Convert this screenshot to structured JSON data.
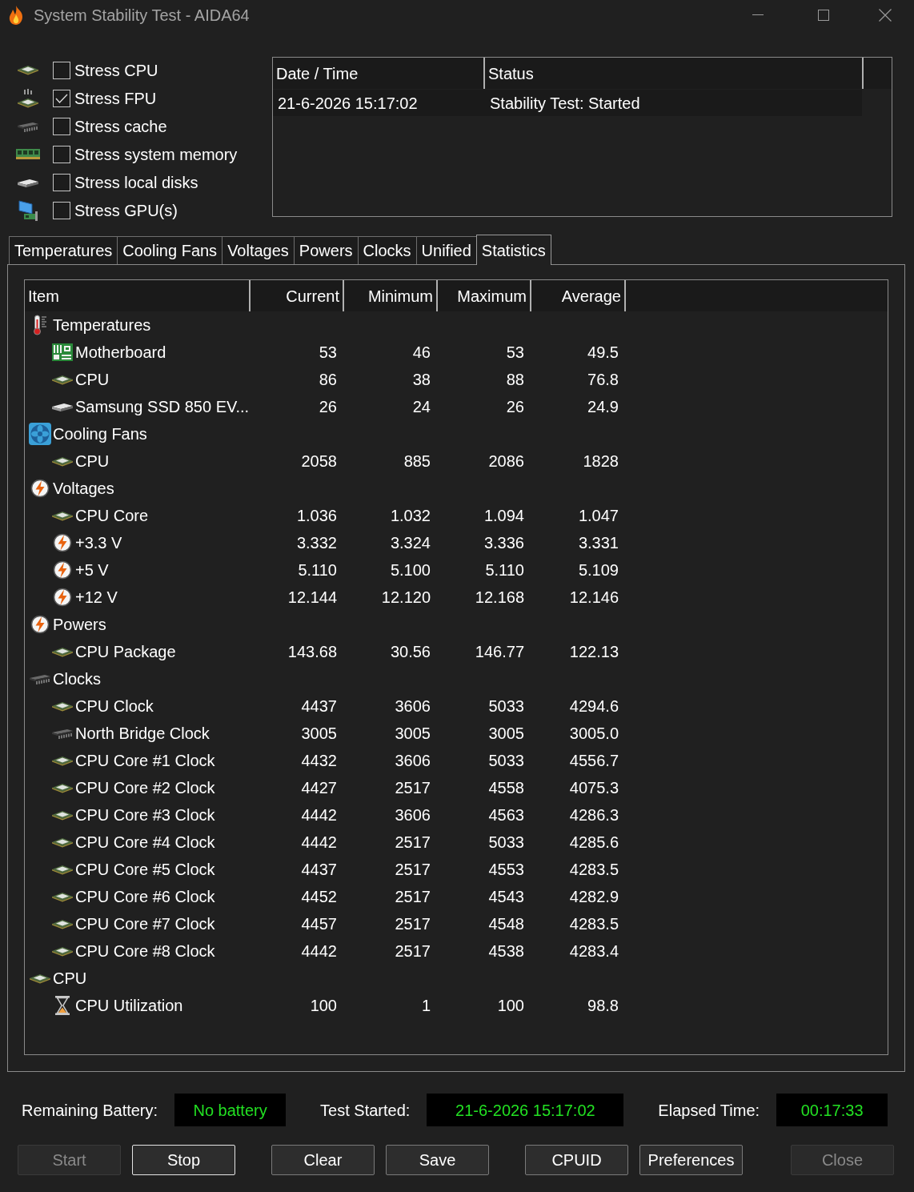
{
  "window": {
    "title": "System Stability Test - AIDA64"
  },
  "stress_options": [
    {
      "label": "Stress CPU",
      "kind": "cpu",
      "checked": false
    },
    {
      "label": "Stress FPU",
      "kind": "fpu",
      "checked": true
    },
    {
      "label": "Stress cache",
      "kind": "cache",
      "checked": false
    },
    {
      "label": "Stress system memory",
      "kind": "memory",
      "checked": false
    },
    {
      "label": "Stress local disks",
      "kind": "disk",
      "checked": false
    },
    {
      "label": "Stress GPU(s)",
      "kind": "gpu",
      "checked": false
    }
  ],
  "log": {
    "columns": [
      "Date / Time",
      "Status"
    ],
    "rows": [
      [
        "21-6-2026 15:17:02",
        "Stability Test: Started"
      ]
    ]
  },
  "tabs": [
    {
      "label": "Temperatures",
      "selected": false
    },
    {
      "label": "Cooling Fans",
      "selected": false
    },
    {
      "label": "Voltages",
      "selected": false
    },
    {
      "label": "Powers",
      "selected": false
    },
    {
      "label": "Clocks",
      "selected": false
    },
    {
      "label": "Unified",
      "selected": false
    },
    {
      "label": "Statistics",
      "selected": true
    }
  ],
  "statistics": {
    "columns": [
      "Item",
      "Current",
      "Minimum",
      "Maximum",
      "Average"
    ],
    "groups": [
      {
        "label": "Temperatures",
        "kind": "temperature",
        "children": [
          {
            "label": "Motherboard",
            "kind": "motherboard",
            "values": [
              "53",
              "46",
              "53",
              "49.5"
            ]
          },
          {
            "label": "CPU",
            "kind": "cpu",
            "values": [
              "86",
              "38",
              "88",
              "76.8"
            ]
          },
          {
            "label": "Samsung SSD 850 EV...",
            "kind": "disk",
            "values": [
              "26",
              "24",
              "26",
              "24.9"
            ]
          }
        ]
      },
      {
        "label": "Cooling Fans",
        "kind": "fan",
        "children": [
          {
            "label": "CPU",
            "kind": "cpu",
            "values": [
              "2058",
              "885",
              "2086",
              "1828"
            ]
          }
        ]
      },
      {
        "label": "Voltages",
        "kind": "voltage",
        "children": [
          {
            "label": "CPU Core",
            "kind": "cpu",
            "values": [
              "1.036",
              "1.032",
              "1.094",
              "1.047"
            ]
          },
          {
            "label": "+3.3 V",
            "kind": "voltage",
            "values": [
              "3.332",
              "3.324",
              "3.336",
              "3.331"
            ]
          },
          {
            "label": "+5 V",
            "kind": "voltage",
            "values": [
              "5.110",
              "5.100",
              "5.110",
              "5.109"
            ]
          },
          {
            "label": "+12 V",
            "kind": "voltage",
            "values": [
              "12.144",
              "12.120",
              "12.168",
              "12.146"
            ]
          }
        ]
      },
      {
        "label": "Powers",
        "kind": "voltage",
        "children": [
          {
            "label": "CPU Package",
            "kind": "cpu",
            "values": [
              "143.68",
              "30.56",
              "146.77",
              "122.13"
            ]
          }
        ]
      },
      {
        "label": "Clocks",
        "kind": "chip",
        "children": [
          {
            "label": "CPU Clock",
            "kind": "cpu",
            "values": [
              "4437",
              "3606",
              "5033",
              "4294.6"
            ]
          },
          {
            "label": "North Bridge Clock",
            "kind": "chip",
            "values": [
              "3005",
              "3005",
              "3005",
              "3005.0"
            ]
          },
          {
            "label": "CPU Core #1 Clock",
            "kind": "cpu",
            "values": [
              "4432",
              "3606",
              "5033",
              "4556.7"
            ]
          },
          {
            "label": "CPU Core #2 Clock",
            "kind": "cpu",
            "values": [
              "4427",
              "2517",
              "4558",
              "4075.3"
            ]
          },
          {
            "label": "CPU Core #3 Clock",
            "kind": "cpu",
            "values": [
              "4442",
              "3606",
              "4563",
              "4286.3"
            ]
          },
          {
            "label": "CPU Core #4 Clock",
            "kind": "cpu",
            "values": [
              "4442",
              "2517",
              "5033",
              "4285.6"
            ]
          },
          {
            "label": "CPU Core #5 Clock",
            "kind": "cpu",
            "values": [
              "4437",
              "2517",
              "4553",
              "4283.5"
            ]
          },
          {
            "label": "CPU Core #6 Clock",
            "kind": "cpu",
            "values": [
              "4452",
              "2517",
              "4543",
              "4282.9"
            ]
          },
          {
            "label": "CPU Core #7 Clock",
            "kind": "cpu",
            "values": [
              "4457",
              "2517",
              "4548",
              "4283.5"
            ]
          },
          {
            "label": "CPU Core #8 Clock",
            "kind": "cpu",
            "values": [
              "4442",
              "2517",
              "4538",
              "4283.4"
            ]
          }
        ]
      },
      {
        "label": "CPU",
        "kind": "cpu",
        "children": [
          {
            "label": "CPU Utilization",
            "kind": "utilization",
            "values": [
              "100",
              "1",
              "100",
              "98.8"
            ]
          }
        ]
      }
    ]
  },
  "status": [
    {
      "label": "Remaining Battery:",
      "value": "No battery"
    },
    {
      "label": "Test Started:",
      "value": "21-6-2026 15:17:02"
    },
    {
      "label": "Elapsed Time:",
      "value": "00:17:33"
    }
  ],
  "button_groups": [
    [
      {
        "label": "Start",
        "disabled": true,
        "focused": false
      },
      {
        "label": "Stop",
        "disabled": false,
        "focused": true
      }
    ],
    [
      {
        "label": "Clear",
        "disabled": false,
        "focused": false
      },
      {
        "label": "Save",
        "disabled": false,
        "focused": false
      }
    ],
    [
      {
        "label": "CPUID",
        "disabled": false,
        "focused": false
      },
      {
        "label": "Preferences",
        "disabled": false,
        "focused": false
      }
    ],
    [
      {
        "label": "Close",
        "disabled": true,
        "focused": false
      }
    ]
  ]
}
